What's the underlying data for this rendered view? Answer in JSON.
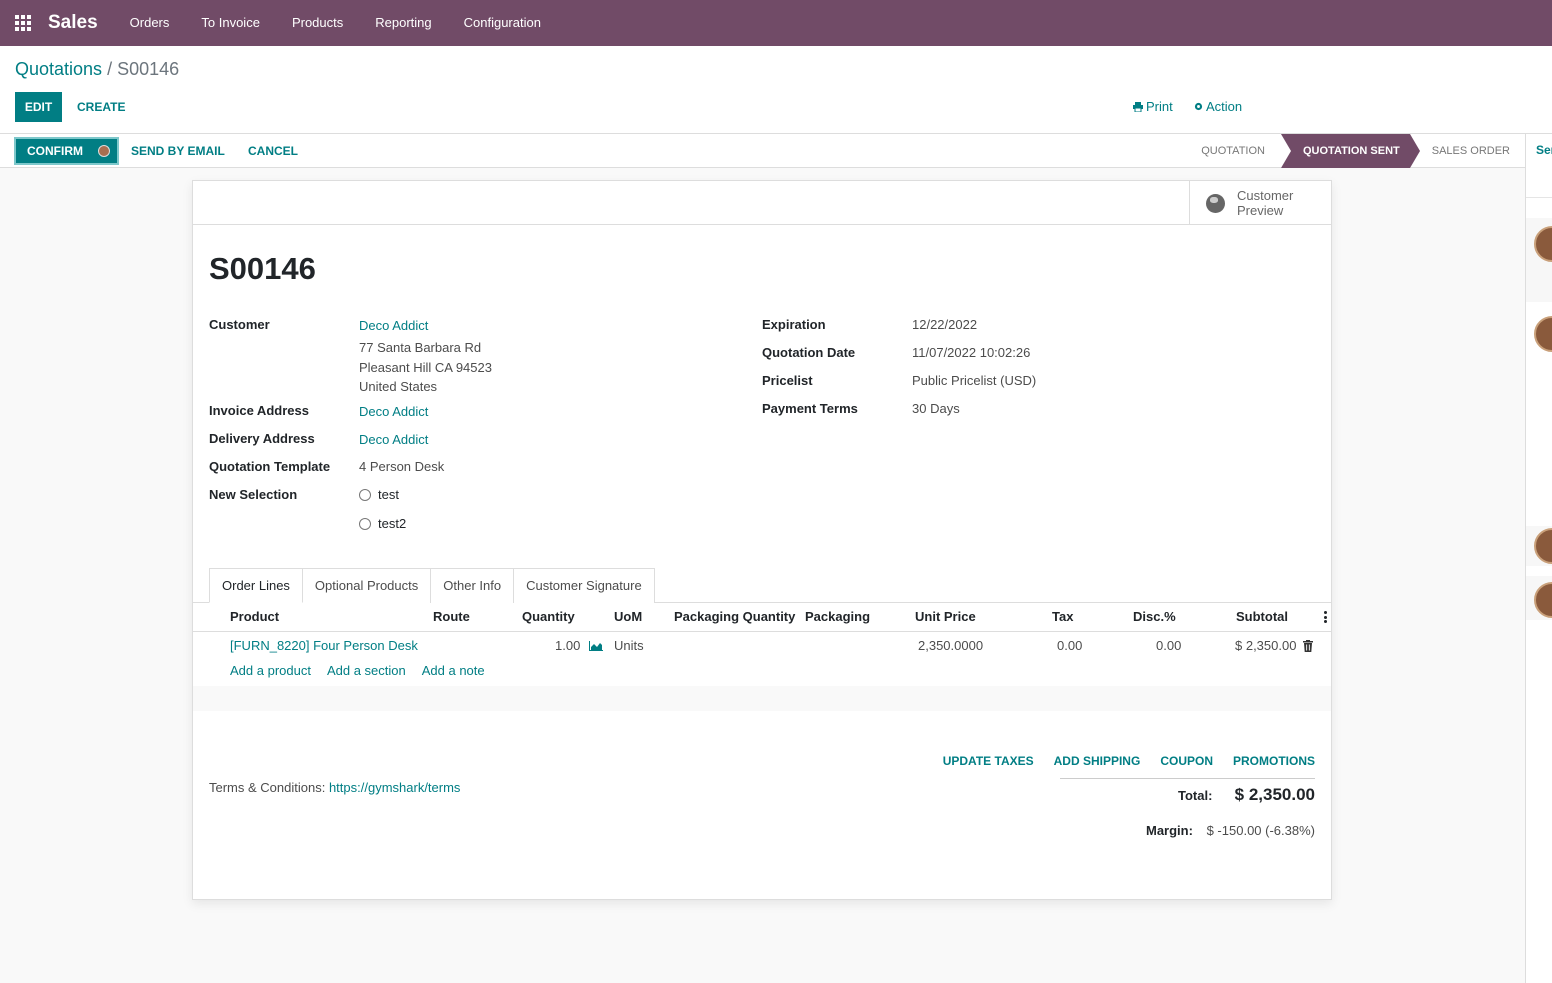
{
  "navbar": {
    "app_name": "Sales",
    "menu": [
      "Orders",
      "To Invoice",
      "Products",
      "Reporting",
      "Configuration"
    ]
  },
  "breadcrumb": {
    "parent": "Quotations",
    "separator": "/",
    "current": "S00146"
  },
  "control": {
    "edit": "EDIT",
    "create": "CREATE",
    "print": "Print",
    "action": "Action"
  },
  "status": {
    "confirm": "CONFIRM",
    "send_by_email": "SEND BY EMAIL",
    "cancel": "CANCEL",
    "stages": [
      "QUOTATION",
      "QUOTATION SENT",
      "SALES ORDER"
    ],
    "active_stage": "QUOTATION SENT"
  },
  "chatter": {
    "send_label": "Send message"
  },
  "sheet": {
    "preview_label": "Customer Preview",
    "title": "S00146",
    "left_fields": {
      "customer_label": "Customer",
      "customer_name": "Deco Addict",
      "address": [
        "77 Santa Barbara Rd",
        "Pleasant Hill CA 94523",
        "United States"
      ],
      "invoice_label": "Invoice Address",
      "invoice_value": "Deco Addict",
      "delivery_label": "Delivery Address",
      "delivery_value": "Deco Addict",
      "template_label": "Quotation Template",
      "template_value": "4 Person Desk",
      "selection_label": "New Selection",
      "selection_options": [
        "test",
        "test2"
      ]
    },
    "right_fields": {
      "expiration_label": "Expiration",
      "expiration_value": "12/22/2022",
      "quotation_date_label": "Quotation Date",
      "quotation_date_value": "11/07/2022 10:02:26",
      "pricelist_label": "Pricelist",
      "pricelist_value": "Public Pricelist (USD)",
      "payment_terms_label": "Payment Terms",
      "payment_terms_value": "30 Days"
    },
    "tabs": [
      "Order Lines",
      "Optional Products",
      "Other Info",
      "Customer Signature"
    ],
    "active_tab": "Order Lines",
    "table": {
      "columns": [
        "Product",
        "Route",
        "Quantity",
        "UoM",
        "Packaging Quantity",
        "Packaging",
        "Unit Price",
        "Tax",
        "Disc.%",
        "Subtotal"
      ],
      "rows": [
        {
          "product": "[FURN_8220] Four Person Desk",
          "route": "",
          "quantity": "1.00",
          "uom": "Units",
          "packaging_quantity": "",
          "packaging": "",
          "unit_price": "2,350.0000",
          "tax": "0.00",
          "discount": "0.00",
          "subtotal": "$ 2,350.00"
        }
      ],
      "add_product": "Add a product",
      "add_section": "Add a section",
      "add_note": "Add a note"
    },
    "actions": [
      "UPDATE TAXES",
      "ADD SHIPPING",
      "COUPON",
      "PROMOTIONS"
    ],
    "terms_label": "Terms & Conditions:",
    "terms_link": "https://gymshark/terms",
    "total_label": "Total:",
    "total_value": "$ 2,350.00",
    "margin_label": "Margin:",
    "margin_value": "$ -150.00 (-6.38%)"
  },
  "colors": {
    "brand": "#714b67",
    "accent": "#017e84"
  }
}
